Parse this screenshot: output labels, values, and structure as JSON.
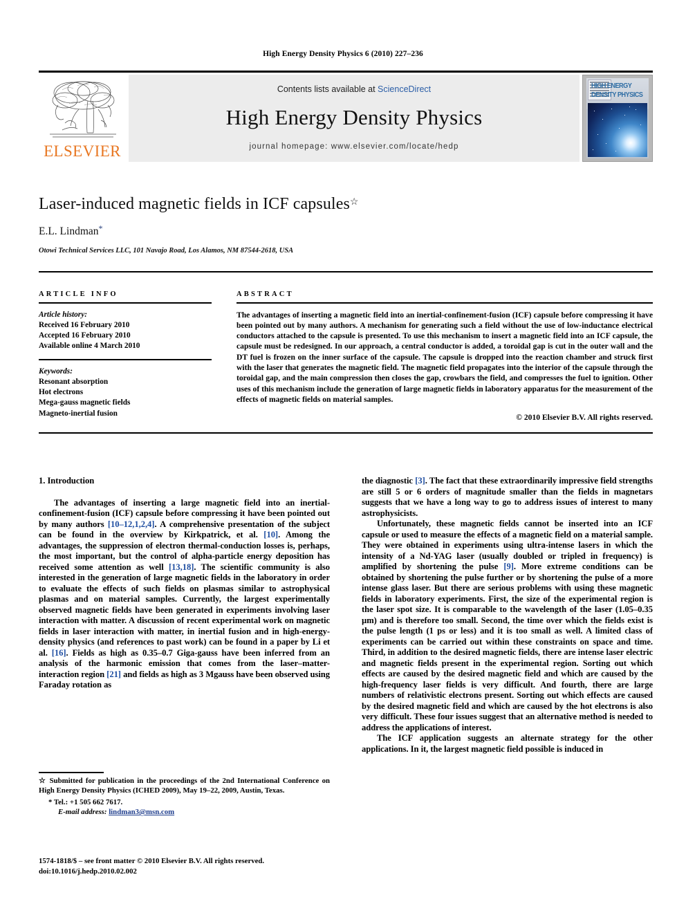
{
  "running_head": "High Energy Density Physics 6 (2010) 227–236",
  "masthead": {
    "publisher_name": "ELSEVIER",
    "contents_prefix": "Contents lists available at ",
    "contents_link": "ScienceDirect",
    "journal_name": "High Energy Density Physics",
    "homepage_line": "journal homepage: www.elsevier.com/locate/hedp",
    "cover_title_line1": "HIGH ENERGY",
    "cover_title_line2": "DENSITY PHYSICS"
  },
  "article": {
    "title": "Laser-induced magnetic fields in ICF capsules",
    "title_footnote_mark": "☆",
    "author": "E.L. Lindman",
    "author_footnote_mark": "*",
    "affiliation": "Otowi Technical Services LLC, 101 Navajo Road, Los Alamos, NM 87544-2618, USA"
  },
  "article_info": {
    "heading": "ARTICLE INFO",
    "history_label": "Article history:",
    "history": [
      "Received 16 February 2010",
      "Accepted 16 February 2010",
      "Available online 4 March 2010"
    ],
    "keywords_label": "Keywords:",
    "keywords": [
      "Resonant absorption",
      "Hot electrons",
      "Mega-gauss magnetic fields",
      "Magneto-inertial fusion"
    ]
  },
  "abstract": {
    "heading": "ABSTRACT",
    "text": "The advantages of inserting a magnetic field into an inertial-confinement-fusion (ICF) capsule before compressing it have been pointed out by many authors. A mechanism for generating such a field without the use of low-inductance electrical conductors attached to the capsule is presented. To use this mechanism to insert a magnetic field into an ICF capsule, the capsule must be redesigned. In our approach, a central conductor is added, a toroidal gap is cut in the outer wall and the DT fuel is frozen on the inner surface of the capsule. The capsule is dropped into the reaction chamber and struck first with the laser that generates the magnetic field. The magnetic field propagates into the interior of the capsule through the toroidal gap, and the main compression then closes the gap, crowbars the field, and compresses the fuel to ignition. Other uses of this mechanism include the generation of large magnetic fields in laboratory apparatus for the measurement of the effects of magnetic fields on material samples.",
    "copyright": "© 2010 Elsevier B.V. All rights reserved."
  },
  "body": {
    "section1_title": "1. Introduction",
    "left_para1_a": "The advantages of inserting a large magnetic field into an inertial-confinement-fusion (ICF) capsule before compressing it have been pointed out by many authors ",
    "left_ref1": "[10–12,1,2,4]",
    "left_para1_b": ". A comprehensive presentation of the subject can be found in the overview by Kirkpatrick, et al. ",
    "left_ref2": "[10]",
    "left_para1_c": ". Among the advantages, the suppression of electron thermal-conduction losses is, perhaps, the most important, but the control of alpha-particle energy deposition has received some attention as well ",
    "left_ref3": "[13,18]",
    "left_para1_d": ". The scientific community is also interested in the generation of large magnetic fields in the laboratory in order to evaluate the effects of such fields on plasmas similar to astrophysical plasmas and on material samples. Currently, the largest experimentally observed magnetic fields have been generated in experiments involving laser interaction with matter. A discussion of recent experimental work on magnetic fields in laser interaction with matter, in inertial fusion and in high-energy-density physics (and references to past work) can be found in a paper by Li et al. ",
    "left_ref4": "[16]",
    "left_para1_e": ". Fields as high as 0.35–0.7 Giga-gauss have been inferred from an analysis of the harmonic emission that comes from the laser–matter-interaction region ",
    "left_ref5": "[21]",
    "left_para1_f": " and fields as high as 3 Mgauss have been observed using Faraday rotation as",
    "right_para1_a": "the diagnostic ",
    "right_ref1": "[3]",
    "right_para1_b": ". The fact that these extraordinarily impressive field strengths are still 5 or 6 orders of magnitude smaller than the fields in magnetars suggests that we have a long way to go to address issues of interest to many astrophysicists.",
    "right_para2_a": "Unfortunately, these magnetic fields cannot be inserted into an ICF capsule or used to measure the effects of a magnetic field on a material sample. They were obtained in experiments using ultra-intense lasers in which the intensity of a Nd-YAG laser (usually doubled or tripled in frequency) is amplified by shortening the pulse ",
    "right_ref2": "[9]",
    "right_para2_b": ". More extreme conditions can be obtained by shortening the pulse further or by shortening the pulse of a more intense glass laser. But there are serious problems with using these magnetic fields in laboratory experiments. First, the size of the experimental region is the laser spot size. It is comparable to the wavelength of the laser (1.05–0.35 µm) and is therefore too small. Second, the time over which the fields exist is the pulse length (1 ps or less) and it is too small as well. A limited class of experiments can be carried out within these constraints on space and time. Third, in addition to the desired magnetic fields, there are intense laser electric and magnetic fields present in the experimental region. Sorting out which effects are caused by the desired magnetic field and which are caused by the high-frequency laser fields is very difficult. And fourth, there are large numbers of relativistic electrons present. Sorting out which effects are caused by the desired magnetic field and which are caused by the hot electrons is also very difficult. These four issues suggest that an alternative method is needed to address the applications of interest.",
    "right_para3": "The ICF application suggests an alternate strategy for the other applications. In it, the largest magnetic field possible is induced in"
  },
  "footnotes": {
    "star_mark": "☆",
    "star_text": "Submitted for publication in the proceedings of the 2nd International Conference on High Energy Density Physics (ICHED 2009), May 19–22, 2009, Austin, Texas.",
    "tel_mark": "*",
    "tel_text": "Tel.: +1 505 662 7617.",
    "email_label": "E-mail address:",
    "email_value": "lindman3@msn.com"
  },
  "imprint": {
    "line1": "1574-1818/$ – see front matter © 2010 Elsevier B.V. All rights reserved.",
    "line2": "doi:10.1016/j.hedp.2010.02.002"
  },
  "colors": {
    "link_blue": "#2B5EA7",
    "ref_blue": "#1F4EA1",
    "elsevier_orange": "#E87722",
    "banner_gray": "#ececec"
  }
}
